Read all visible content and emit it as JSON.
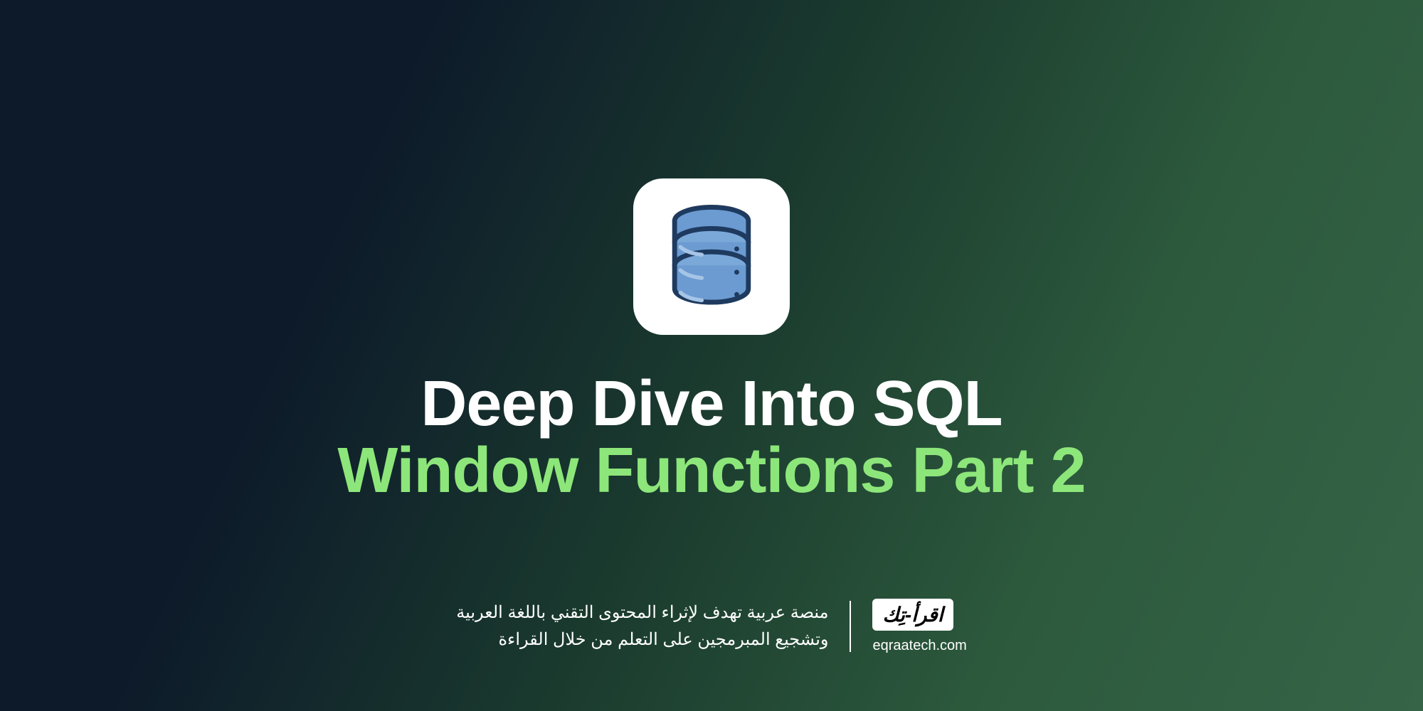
{
  "title": {
    "line1": "Deep Dive Into SQL",
    "line2": "Window Functions Part 2"
  },
  "description": {
    "line1": "منصة عربية تهدف لإثراء المحتوى التقني باللغة العربية",
    "line2": "وتشجيع المبرمجين على التعلم من خلال القراءة"
  },
  "brand": {
    "name": "اقرأ-تِك",
    "url": "eqraatech.com"
  },
  "colors": {
    "accent": "#8de67a",
    "text_primary": "#ffffff",
    "bg_dark": "#0d1a2a",
    "bg_green": "#356447"
  },
  "icon": {
    "name": "database-icon"
  }
}
